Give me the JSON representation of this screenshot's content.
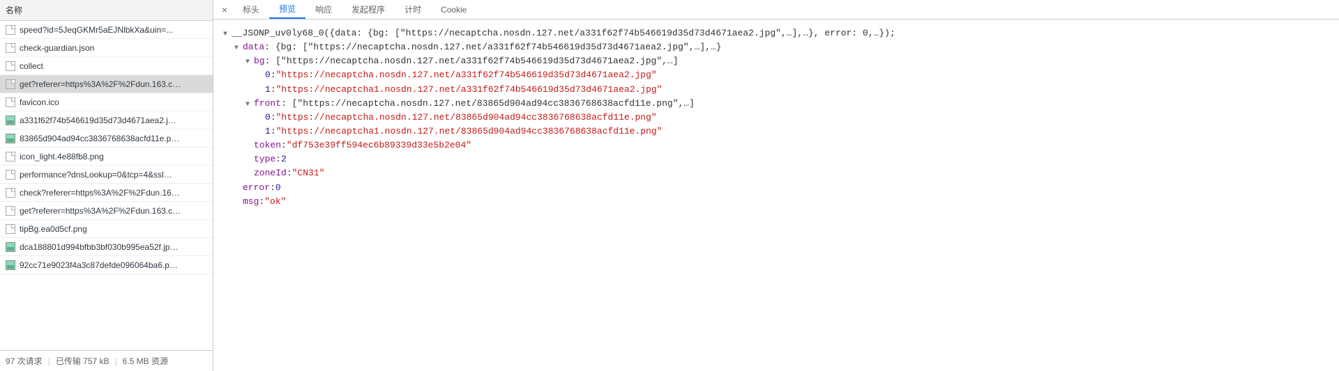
{
  "leftPanel": {
    "headerLabel": "名称",
    "requests": [
      {
        "name": "speed?id=5JeqGKMr5aEJNlbkXa&uin=...",
        "icon": "doc",
        "selected": false
      },
      {
        "name": "check-guardian.json",
        "icon": "doc",
        "selected": false
      },
      {
        "name": "collect",
        "icon": "doc",
        "selected": false
      },
      {
        "name": "get?referer=https%3A%2F%2Fdun.163.c…",
        "icon": "doc",
        "selected": true
      },
      {
        "name": "favicon.ico",
        "icon": "doc",
        "selected": false
      },
      {
        "name": "a331f62f74b546619d35d73d4671aea2.j…",
        "icon": "img",
        "selected": false
      },
      {
        "name": "83865d904ad94cc3836768638acfd11e.p…",
        "icon": "img",
        "selected": false
      },
      {
        "name": "icon_light.4e88fb8.png",
        "icon": "doc",
        "selected": false
      },
      {
        "name": "performance?dnsLookup=0&tcp=4&ssl…",
        "icon": "doc",
        "selected": false
      },
      {
        "name": "check?referer=https%3A%2F%2Fdun.16…",
        "icon": "doc",
        "selected": false
      },
      {
        "name": "get?referer=https%3A%2F%2Fdun.163.c…",
        "icon": "doc",
        "selected": false
      },
      {
        "name": "tipBg.ea0d5cf.png",
        "icon": "doc",
        "selected": false
      },
      {
        "name": "dca188801d994bfbb3bf030b995ea52f.jp…",
        "icon": "img",
        "selected": false
      },
      {
        "name": "92cc71e9023f4a3c87defde096064ba6.p…",
        "icon": "img",
        "selected": false
      }
    ],
    "footer": {
      "requestsText": "97 次请求",
      "transferredText": "已传输 757 kB",
      "resourcesText": "6.5 MB 资源"
    }
  },
  "tabs": {
    "items": [
      {
        "label": "标头",
        "active": false
      },
      {
        "label": "预览",
        "active": true
      },
      {
        "label": "响应",
        "active": false
      },
      {
        "label": "发起程序",
        "active": false
      },
      {
        "label": "计时",
        "active": false
      },
      {
        "label": "Cookie",
        "active": false
      }
    ]
  },
  "preview": {
    "rootLine": "__JSONP_uv0ly68_0({data: {bg: [\"https://necaptcha.nosdn.127.net/a331f62f74b546619d35d73d4671aea2.jpg\",…],…}, error: 0,…});",
    "dataKey": "data",
    "dataSuffix": ": {bg: [\"https://necaptcha.nosdn.127.net/a331f62f74b546619d35d73d4671aea2.jpg\",…],…}",
    "bgKey": "bg",
    "bgSuffix": ": [\"https://necaptcha.nosdn.127.net/a331f62f74b546619d35d73d4671aea2.jpg\",…]",
    "bg0Idx": "0",
    "bg0Val": "\"https://necaptcha.nosdn.127.net/a331f62f74b546619d35d73d4671aea2.jpg\"",
    "bg1Idx": "1",
    "bg1Val": "\"https://necaptcha1.nosdn.127.net/a331f62f74b546619d35d73d4671aea2.jpg\"",
    "frontKey": "front",
    "frontSuffix": ": [\"https://necaptcha.nosdn.127.net/83865d904ad94cc3836768638acfd11e.png\",…]",
    "front0Idx": "0",
    "front0Val": "\"https://necaptcha.nosdn.127.net/83865d904ad94cc3836768638acfd11e.png\"",
    "front1Idx": "1",
    "front1Val": "\"https://necaptcha1.nosdn.127.net/83865d904ad94cc3836768638acfd11e.png\"",
    "tokenKey": "token",
    "tokenVal": "\"df753e39ff594ec6b89339d33e5b2e04\"",
    "typeKey": "type",
    "typeVal": "2",
    "zoneIdKey": "zoneId",
    "zoneIdVal": "\"CN31\"",
    "errorKey": "error",
    "errorVal": "0",
    "msgKey": "msg",
    "msgVal": "\"ok\"",
    "colon": ": "
  }
}
